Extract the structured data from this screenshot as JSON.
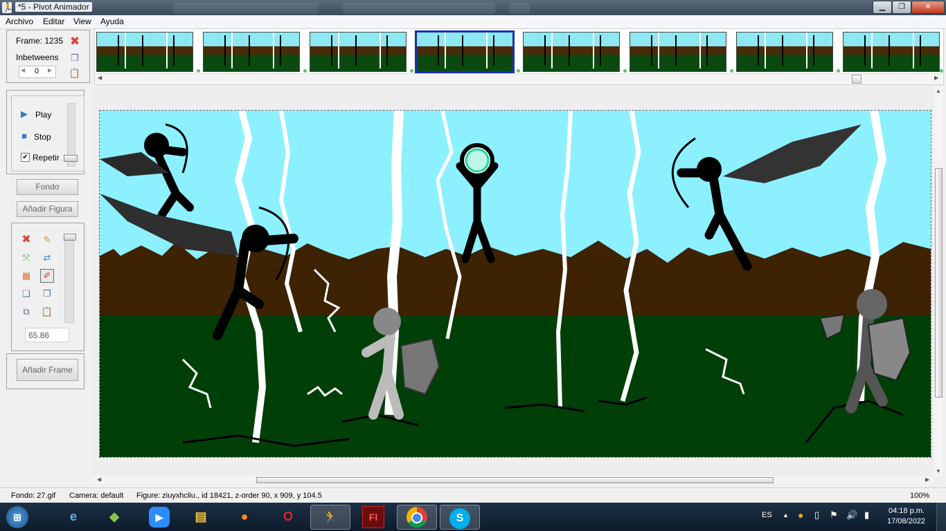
{
  "window": {
    "title": "*5 - Pivot Animador"
  },
  "menu": [
    "Archivo",
    "Editar",
    "View",
    "Ayuda"
  ],
  "frame_panel": {
    "frame_label": "Frame: 1235",
    "inbetweens_label": "Inbetweens",
    "inbetweens_value": "0"
  },
  "playback": {
    "play": "Play",
    "stop": "Stop",
    "repeat": "Repetir"
  },
  "buttons": {
    "background": "Fondo",
    "add_figure": "Añadir Figura",
    "add_frame": "Añadir Frame"
  },
  "figure_tools": {
    "value": "65.86"
  },
  "timeline": {
    "selected_index": 3,
    "count": 8
  },
  "status": {
    "background": "Fondo: 27.gif",
    "camera": "Camera: default",
    "figure": "Figure: ziuyxhcliu.,  id 18421,  z-order 90,  x 909, y 104.5",
    "zoom": "100%"
  },
  "taskbar": {
    "language": "ES",
    "time": "04:18 p.m.",
    "date": "17/08/2022",
    "apps": [
      "start-orb",
      "internet-explorer",
      "minecraft",
      "zoom",
      "file-explorer",
      "firefox",
      "opera",
      "pivot-animator",
      "flash",
      "chrome",
      "skype"
    ]
  },
  "colors": {
    "sky": "#8df0ff",
    "dirt": "#3d2203",
    "grass": "#003f08",
    "selected_frame": "#1a2fb3"
  }
}
